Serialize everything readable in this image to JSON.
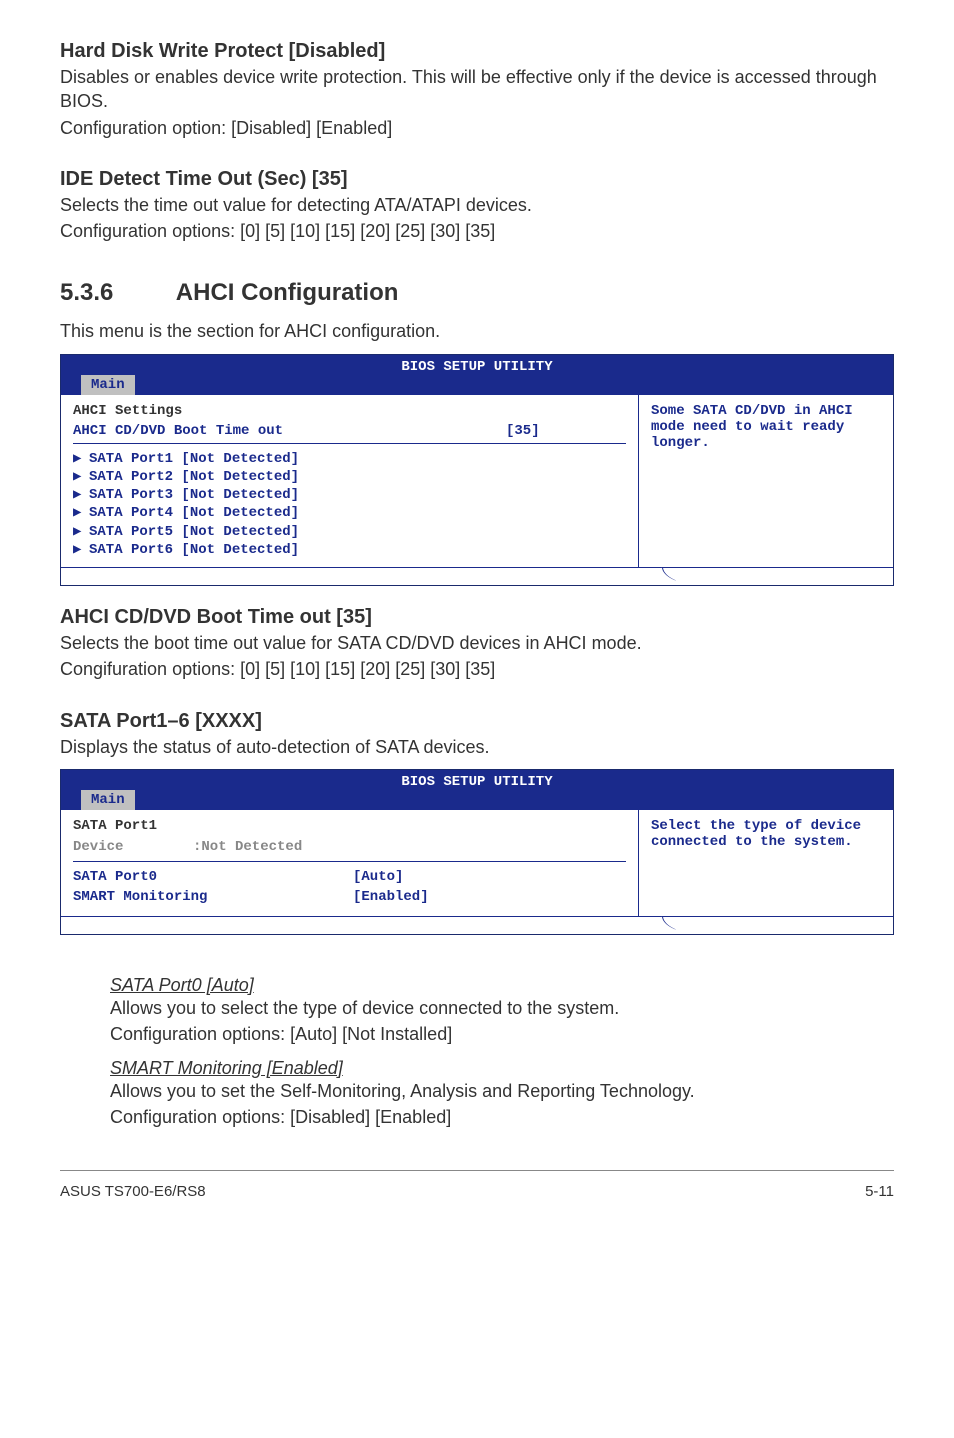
{
  "s1": {
    "title": "Hard Disk Write Protect [Disabled]",
    "line1": "Disables or enables device write protection. This will be effective only if the device is accessed through BIOS.",
    "line2": "Configuration option: [Disabled] [Enabled]"
  },
  "s2": {
    "title": "IDE Detect Time Out (Sec) [35]",
    "line1": "Selects the time out value for detecting ATA/ATAPI devices.",
    "line2": "Configuration options: [0] [5] [10] [15] [20] [25] [30] [35]"
  },
  "sec": {
    "num": "5.3.6",
    "title": "AHCI Configuration",
    "intro": "This menu is the section for AHCI configuration."
  },
  "bios1": {
    "header": "BIOS SETUP UTILITY",
    "tab": "Main",
    "settings_title": "AHCI Settings",
    "boot_label": "AHCI CD/DVD Boot Time out",
    "boot_value": "[35]",
    "ports": [
      "SATA Port1 [Not Detected]",
      "SATA Port2 [Not Detected]",
      "SATA Port3 [Not Detected]",
      "SATA Port4 [Not Detected]",
      "SATA Port5 [Not Detected]",
      "SATA Port6 [Not Detected]"
    ],
    "help": "Some SATA CD/DVD in AHCI mode need to wait ready longer."
  },
  "s3": {
    "title": "AHCI CD/DVD Boot Time out [35]",
    "line1": "Selects the boot time out value for SATA CD/DVD devices in AHCI mode.",
    "line2": "Congifuration options: [0] [5] [10] [15] [20] [25] [30] [35]"
  },
  "s4": {
    "title": "SATA Port1–6 [XXXX]",
    "line1": "Displays the status of auto-detection of SATA devices."
  },
  "bios2": {
    "header": "BIOS SETUP UTILITY",
    "tab": "Main",
    "port_title": "SATA Port1",
    "device_label": "Device",
    "device_value": ":Not Detected",
    "r1_label": "SATA Port0",
    "r1_value": "[Auto]",
    "r2_label": "SMART Monitoring",
    "r2_value": "[Enabled]",
    "help": "Select the type of device connected to the system."
  },
  "sub1": {
    "title": "SATA Port0 [Auto]",
    "line1": "Allows you to select the type of device connected to the system.",
    "line2": "Configuration options: [Auto] [Not Installed]"
  },
  "sub2": {
    "title": "SMART Monitoring [Enabled]",
    "line1": "Allows you to set the Self-Monitoring, Analysis and Reporting Technology.",
    "line2": "Configuration options: [Disabled] [Enabled]"
  },
  "footer": {
    "left": "ASUS TS700-E6/RS8",
    "right": "5-11"
  }
}
